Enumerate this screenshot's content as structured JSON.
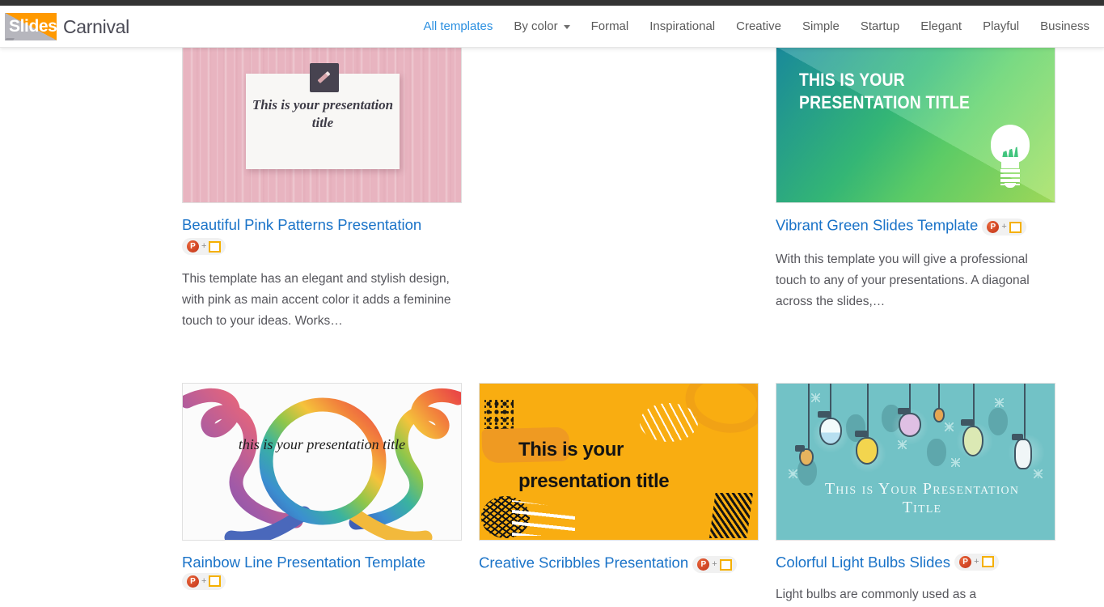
{
  "site": {
    "logo_word": "Slides",
    "logo_name": "Carnival"
  },
  "nav": {
    "items": [
      {
        "label": "All templates",
        "active": true,
        "dropdown": false
      },
      {
        "label": "By color",
        "active": false,
        "dropdown": true
      },
      {
        "label": "Formal",
        "active": false,
        "dropdown": false
      },
      {
        "label": "Inspirational",
        "active": false,
        "dropdown": false
      },
      {
        "label": "Creative",
        "active": false,
        "dropdown": false
      },
      {
        "label": "Simple",
        "active": false,
        "dropdown": false
      },
      {
        "label": "Startup",
        "active": false,
        "dropdown": false
      },
      {
        "label": "Elegant",
        "active": false,
        "dropdown": false
      },
      {
        "label": "Playful",
        "active": false,
        "dropdown": false
      },
      {
        "label": "Business",
        "active": false,
        "dropdown": false
      }
    ]
  },
  "badge": {
    "powerpoint_label": "P",
    "plus": "+",
    "icon_names": [
      "powerpoint-icon",
      "google-slides-icon"
    ]
  },
  "cards": [
    {
      "id": "beautiful-pink-patterns",
      "title": "Beautiful Pink Patterns Presentation",
      "description": "This template has an elegant and stylish design, with pink as main accent color it adds a feminine touch to your ideas. Works…",
      "thumb_text": "This is your presentation title",
      "accent": "#e8b4c0"
    },
    {
      "id": "vibrant-green-slides",
      "title": "Vibrant Green Slides Template",
      "description": "With this template you will give a professional touch to any of your presentations. A diagonal across the slides,…",
      "thumb_text_line1": "THIS IS YOUR",
      "thumb_text_line2": "PRESENTATION TITLE",
      "accent": "#36bd7a"
    },
    {
      "id": "rainbow-line-presentation",
      "title": "Rainbow Line Presentation Template",
      "description": "",
      "thumb_text": "this is your presentation title",
      "accent": "#3aa3c9"
    },
    {
      "id": "creative-scribbles",
      "title": "Creative Scribbles Presentation",
      "description": "",
      "thumb_text_line1": "This is your",
      "thumb_text_line2": "presentation title",
      "accent": "#f9ad11"
    },
    {
      "id": "colorful-light-bulbs",
      "title": "Colorful Light Bulbs Slides",
      "description": "Light bulbs are commonly used as a",
      "thumb_text": "This is Your Presentation Title",
      "accent": "#72c2c6"
    }
  ],
  "colors": {
    "link": "#1a73c8",
    "nav_active": "#2a8fe0",
    "nav_text": "#5b5b5b",
    "body_text": "#56565c",
    "logo_orange": "#ff9900",
    "logo_gray": "#b6b6bd",
    "top_strip": "#333333"
  }
}
